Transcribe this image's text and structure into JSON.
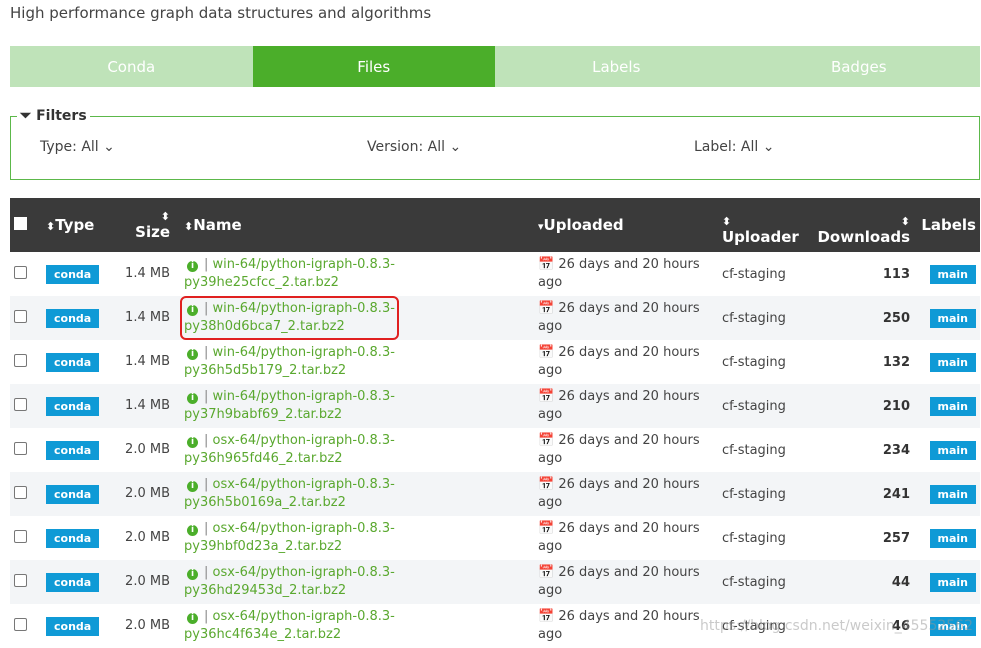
{
  "subtitle": "High performance graph data structures and algorithms",
  "tabs": [
    "Conda",
    "Files",
    "Labels",
    "Badges"
  ],
  "filters": {
    "title": "Filters",
    "type": "Type: All",
    "version": "Version: All",
    "label": "Label: All"
  },
  "columns": {
    "type": "Type",
    "size": "Size",
    "name": "Name",
    "uploaded": "Uploaded",
    "uploader": "Uploader",
    "downloads": "Downloads",
    "labels": "Labels"
  },
  "rows": [
    {
      "type": "conda",
      "size": "1.4 MB",
      "name1": "win-64/python-igraph-0.8.3-",
      "name2": "py39he25cfcc_2.tar.bz2",
      "uploaded": "26 days and 20 hours ago",
      "uploader": "cf-staging",
      "downloads": "113",
      "label": "main"
    },
    {
      "type": "conda",
      "size": "1.4 MB",
      "name1": "win-64/python-igraph-0.8.3-",
      "name2": "py38h0d6bca7_2.tar.bz2",
      "uploaded": "26 days and 20 hours ago",
      "uploader": "cf-staging",
      "downloads": "250",
      "label": "main"
    },
    {
      "type": "conda",
      "size": "1.4 MB",
      "name1": "win-64/python-igraph-0.8.3-",
      "name2": "py36h5d5b179_2.tar.bz2",
      "uploaded": "26 days and 20 hours ago",
      "uploader": "cf-staging",
      "downloads": "132",
      "label": "main"
    },
    {
      "type": "conda",
      "size": "1.4 MB",
      "name1": "win-64/python-igraph-0.8.3-",
      "name2": "py37h9babf69_2.tar.bz2",
      "uploaded": "26 days and 20 hours ago",
      "uploader": "cf-staging",
      "downloads": "210",
      "label": "main"
    },
    {
      "type": "conda",
      "size": "2.0 MB",
      "name1": "osx-64/python-igraph-0.8.3-",
      "name2": "py36h965fd46_2.tar.bz2",
      "uploaded": "26 days and 20 hours ago",
      "uploader": "cf-staging",
      "downloads": "234",
      "label": "main"
    },
    {
      "type": "conda",
      "size": "2.0 MB",
      "name1": "osx-64/python-igraph-0.8.3-",
      "name2": "py36h5b0169a_2.tar.bz2",
      "uploaded": "26 days and 20 hours ago",
      "uploader": "cf-staging",
      "downloads": "241",
      "label": "main"
    },
    {
      "type": "conda",
      "size": "2.0 MB",
      "name1": "osx-64/python-igraph-0.8.3-",
      "name2": "py39hbf0d23a_2.tar.bz2",
      "uploaded": "26 days and 20 hours ago",
      "uploader": "cf-staging",
      "downloads": "257",
      "label": "main"
    },
    {
      "type": "conda",
      "size": "2.0 MB",
      "name1": "osx-64/python-igraph-0.8.3-",
      "name2": "py36hd29453d_2.tar.bz2",
      "uploaded": "26 days and 20 hours ago",
      "uploader": "cf-staging",
      "downloads": "44",
      "label": "main"
    },
    {
      "type": "conda",
      "size": "2.0 MB",
      "name1": "osx-64/python-igraph-0.8.3-",
      "name2": "py36hc4f634e_2.tar.bz2",
      "uploaded": "26 days and 20 hours ago",
      "uploader": "cf-staging",
      "downloads": "46",
      "label": "main"
    }
  ],
  "highlighted_row": 1,
  "watermark": "https://blog.csdn.net/weixin_45552562"
}
